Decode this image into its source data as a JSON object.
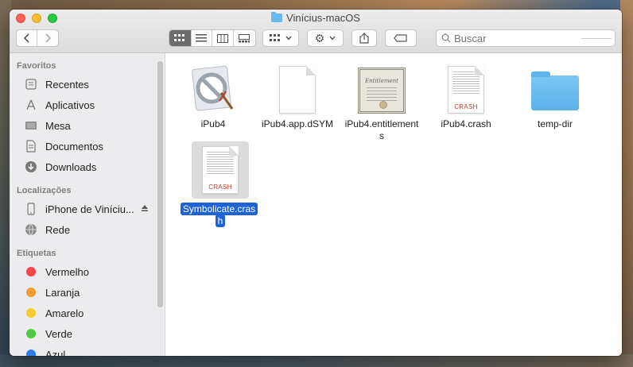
{
  "window": {
    "title": "Vinícius-macOS"
  },
  "toolbar": {
    "search_placeholder": "Buscar",
    "view_modes": [
      "icon-view",
      "list-view",
      "column-view",
      "gallery-view"
    ],
    "active_view": "icon-view"
  },
  "sidebar": {
    "sections": {
      "favorites": "Favoritos",
      "locations": "Localizações",
      "tags": "Etiquetas"
    },
    "favorites": [
      {
        "label": "Recentes",
        "icon": "recents-icon"
      },
      {
        "label": "Aplicativos",
        "icon": "applications-icon"
      },
      {
        "label": "Mesa",
        "icon": "desktop-icon"
      },
      {
        "label": "Documentos",
        "icon": "documents-icon"
      },
      {
        "label": "Downloads",
        "icon": "downloads-icon"
      }
    ],
    "locations": [
      {
        "label": "iPhone de Viníciu...",
        "icon": "iphone-icon"
      },
      {
        "label": "Rede",
        "icon": "network-icon"
      }
    ],
    "tags": [
      {
        "label": "Vermelho",
        "color": "#f2474b"
      },
      {
        "label": "Laranja",
        "color": "#f79b2e"
      },
      {
        "label": "Amarelo",
        "color": "#f7cd2e"
      },
      {
        "label": "Verde",
        "color": "#50c746"
      },
      {
        "label": "Azul",
        "color": "#2f7bf0"
      }
    ]
  },
  "files": [
    {
      "name": "iPub4",
      "kind": "application"
    },
    {
      "name": "iPub4.app.dSYM",
      "kind": "document"
    },
    {
      "name": "iPub4.entitlements",
      "kind": "certificate"
    },
    {
      "name": "iPub4.crash",
      "kind": "crash",
      "badge": "CRASH"
    },
    {
      "name": "temp-dir",
      "kind": "folder"
    },
    {
      "name": "Symbolicate.crash",
      "kind": "crash",
      "badge": "CRASH",
      "selected": true
    }
  ],
  "colors": {
    "selection": "#1f63d2",
    "folder": "#6ab8ec"
  }
}
